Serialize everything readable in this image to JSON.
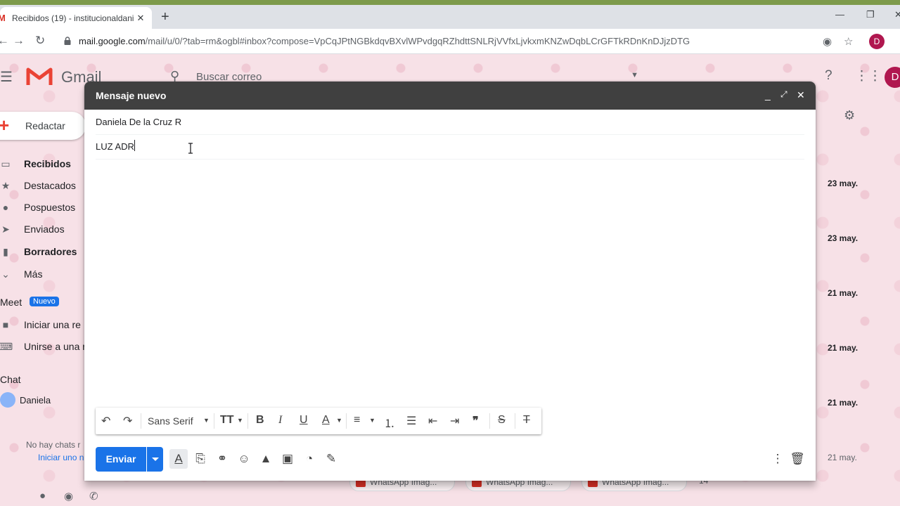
{
  "browser": {
    "tab_title": "Recibidos (19) - institucionaldani",
    "url_host": "mail.google.com",
    "url_path": "/mail/u/0/?tab=rm&ogbl#inbox?compose=VpCqJPtNGBkdqvBXvlWPvdgqRZhdttSNLRjVVfxLjvkxmKNZwDqbLCrGFTkRDnKnDJjzDTG",
    "profile_initial": "D"
  },
  "gmail": {
    "logo_text": "Gmail",
    "search_placeholder": "Buscar correo",
    "avatar_initial": "D",
    "compose_label": "Redactar",
    "sidebar": [
      {
        "label": "Recibidos",
        "bold": true,
        "icon": "inbox-icon"
      },
      {
        "label": "Destacados",
        "bold": false,
        "icon": "star-icon"
      },
      {
        "label": "Pospuestos",
        "bold": false,
        "icon": "clock-icon"
      },
      {
        "label": "Enviados",
        "bold": false,
        "icon": "send-icon"
      },
      {
        "label": "Borradores",
        "bold": true,
        "icon": "draft-icon"
      },
      {
        "label": "Más",
        "bold": false,
        "icon": "chevron-down-icon"
      }
    ],
    "meet": {
      "label": "Meet",
      "badge": "Nuevo",
      "items": [
        "Iniciar una re",
        "Unirse a una r"
      ]
    },
    "chat": {
      "label": "Chat",
      "user": "Daniela",
      "no_chats": "No hay chats r",
      "start_chat": "Iniciar uno n"
    },
    "email_dates": [
      "23 may.",
      "23 may.",
      "21 may.",
      "21 may.",
      "21 may.",
      "21 may."
    ],
    "attachments": [
      "WhatsApp Imag...",
      "WhatsApp Imag...",
      "WhatsApp Imag..."
    ],
    "more_attachments": "14"
  },
  "compose": {
    "title": "Mensaje nuevo",
    "to": "Daniela De la Cruz R",
    "subject": "LUZ ADR",
    "font_name": "Sans Serif",
    "send_label": "Enviar"
  },
  "colors": {
    "send_blue": "#1a73e8",
    "compose_header": "#404040",
    "profile_magenta": "#b0174f"
  }
}
